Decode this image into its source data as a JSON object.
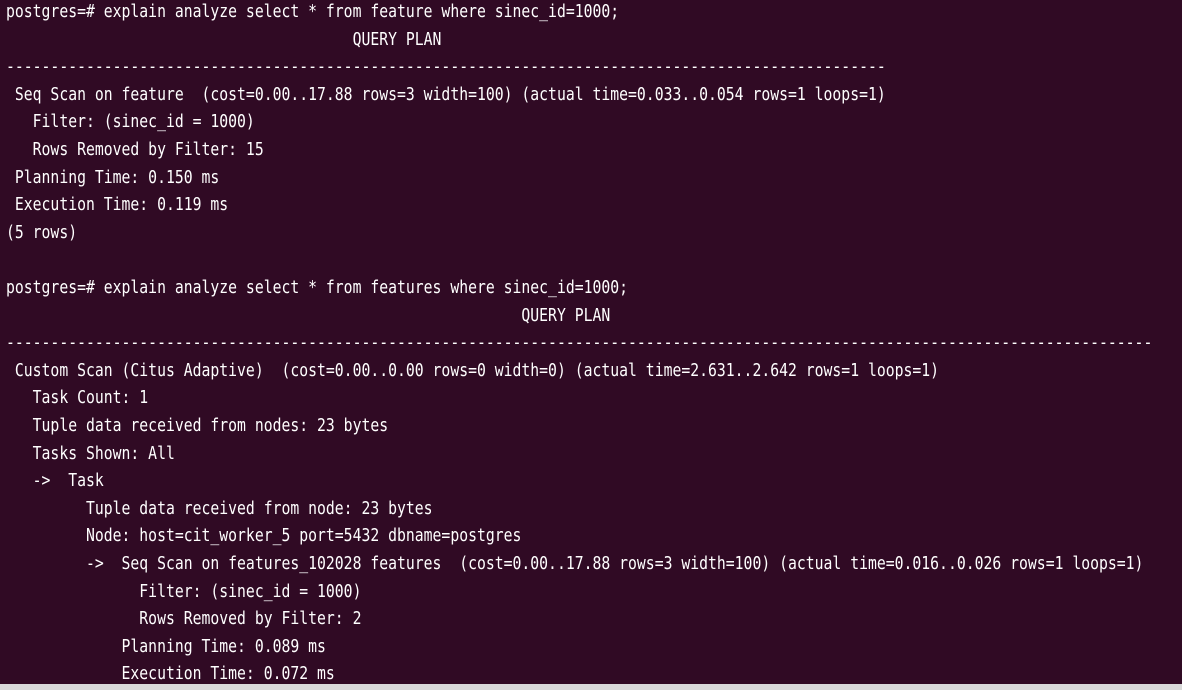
{
  "terminal": {
    "background": "#300a24",
    "foreground": "#ffffff",
    "lines": [
      "postgres=# explain analyze select * from feature where sinec_id=1000;",
      "                                       QUERY PLAN",
      "---------------------------------------------------------------------------------------------------",
      " Seq Scan on feature  (cost=0.00..17.88 rows=3 width=100) (actual time=0.033..0.054 rows=1 loops=1)",
      "   Filter: (sinec_id = 1000)",
      "   Rows Removed by Filter: 15",
      " Planning Time: 0.150 ms",
      " Execution Time: 0.119 ms",
      "(5 rows)",
      "",
      "postgres=# explain analyze select * from features where sinec_id=1000;",
      "                                                          QUERY PLAN",
      "---------------------------------------------------------------------------------------------------------------------------------",
      " Custom Scan (Citus Adaptive)  (cost=0.00..0.00 rows=0 width=0) (actual time=2.631..2.642 rows=1 loops=1)",
      "   Task Count: 1",
      "   Tuple data received from nodes: 23 bytes",
      "   Tasks Shown: All",
      "   ->  Task",
      "         Tuple data received from node: 23 bytes",
      "         Node: host=cit_worker_5 port=5432 dbname=postgres",
      "         ->  Seq Scan on features_102028 features  (cost=0.00..17.88 rows=3 width=100) (actual time=0.016..0.026 rows=1 loops=1)",
      "               Filter: (sinec_id = 1000)",
      "               Rows Removed by Filter: 2",
      "             Planning Time: 0.089 ms",
      "             Execution Time: 0.072 ms"
    ]
  }
}
